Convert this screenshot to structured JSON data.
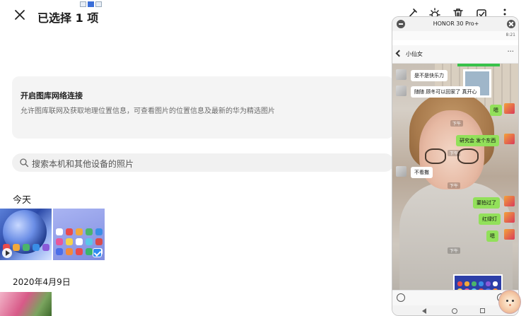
{
  "header": {
    "title": "已选择 1 项"
  },
  "network_card": {
    "title": "开启图库网络连接",
    "description": "允许图库联网及获取地理位置信息，可查看图片的位置信息及最新的华为精选图片"
  },
  "search": {
    "placeholder": "搜索本机和其他设备的照片"
  },
  "sections": {
    "today": "今天",
    "date": "2020年4月9日"
  },
  "toolbar_icons": [
    "edit-icon",
    "brightness-icon",
    "delete-icon",
    "select-all-icon",
    "more-icon"
  ],
  "projection": {
    "window_title": "HONOR 30 Pro+",
    "status_time": "8:21",
    "chat": {
      "contact": "小仙女",
      "more": "···",
      "messages": [
        {
          "side": "in",
          "text": "是不是快乐力"
        },
        {
          "side": "in",
          "text": "随随 顾冬可以回家了 真开心"
        },
        {
          "side": "out",
          "text": "嗯"
        },
        {
          "side": "out",
          "text": "研究会 发个东西"
        },
        {
          "side": "in",
          "text": "不看撒"
        },
        {
          "side": "out",
          "text": "要拍过了"
        },
        {
          "side": "out",
          "text": "红绿灯"
        },
        {
          "side": "out",
          "text": "嗯"
        }
      ]
    }
  },
  "colors": {
    "accent": "#2f8cf0",
    "chat_bubble_out": "#92e05a",
    "card_bg": "#f4f4f4"
  }
}
